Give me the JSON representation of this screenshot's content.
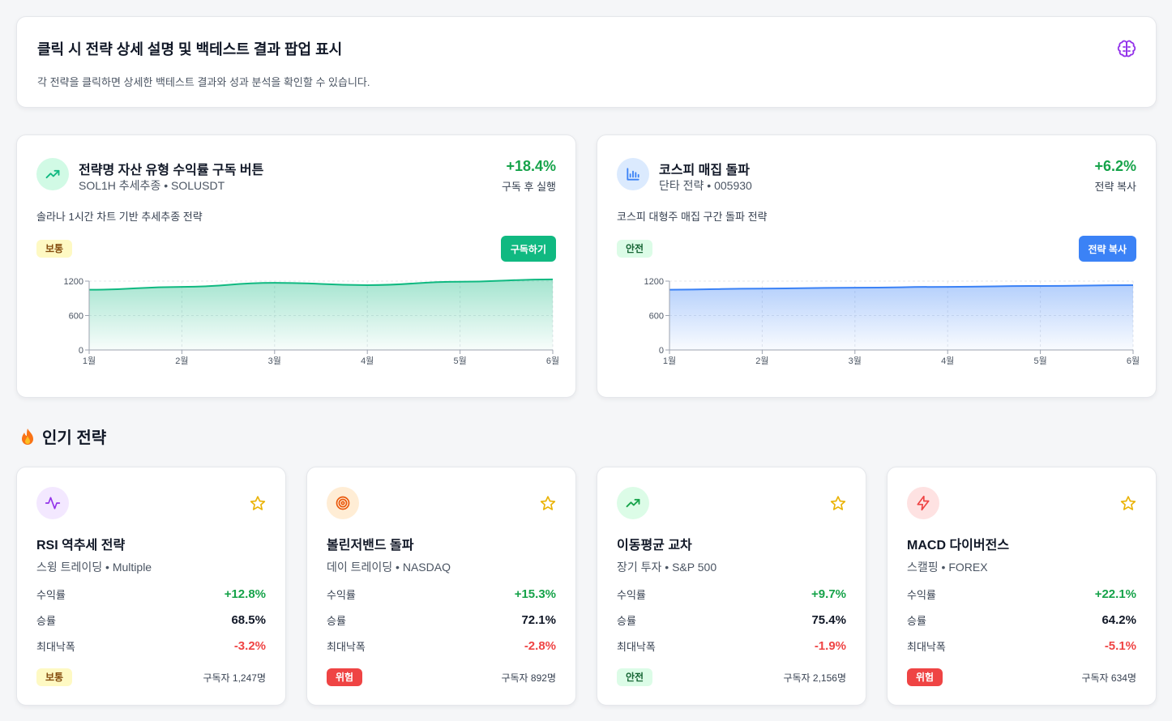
{
  "info": {
    "title": "클릭 시 전략 상세 설명 및 백테스트 결과 팝업 표시",
    "description": "각 전략을 클릭하면 상세한 백테스트 결과와 성과 분석을 확인할 수 있습니다.",
    "icon": "brain-icon",
    "icon_color": "#9333ea"
  },
  "strategies": [
    {
      "icon": "trending-up-icon",
      "name": "전략명 자산 유형 수익률 구독 버튼",
      "subtitle": "SOL1H 추세추종 • SOLUSDT",
      "return": "+18.4%",
      "return_label": "구독 후 실행",
      "description": "솔라나 1시간 차트 기반 추세추종 전략",
      "risk": "보통",
      "action": "구독하기",
      "accent": "#10b981",
      "chart_data": {
        "type": "area",
        "x": [
          "1월",
          "2월",
          "3월",
          "4월",
          "5월",
          "6월"
        ],
        "y_ticks": [
          "0",
          "600",
          "1200"
        ],
        "ylim": [
          0,
          1200
        ],
        "values": [
          1050,
          1100,
          1170,
          1130,
          1190,
          1230
        ]
      }
    },
    {
      "icon": "bar-chart-icon",
      "name": "코스피 매집 돌파",
      "subtitle": "단타 전략 • 005930",
      "return": "+6.2%",
      "return_label": "전략 복사",
      "description": "코스피 대형주 매집 구간 돌파 전략",
      "risk": "안전",
      "action": "전략 복사",
      "accent": "#3b82f6",
      "chart_data": {
        "type": "area",
        "x": [
          "1월",
          "2월",
          "3월",
          "4월",
          "5월",
          "6월"
        ],
        "y_ticks": [
          "0",
          "600",
          "1200"
        ],
        "ylim": [
          0,
          1200
        ],
        "values": [
          1050,
          1070,
          1085,
          1100,
          1115,
          1130
        ]
      }
    }
  ],
  "popular": {
    "title": "인기 전략",
    "icon": "fire-icon",
    "items": [
      {
        "icon": "activity-icon",
        "icon_bg": "#f3e8ff",
        "icon_color": "#9333ea",
        "name": "RSI 역추세 전략",
        "subtitle": "스윙 트레이딩 • Multiple",
        "return_label": "수익률",
        "return": "+12.8%",
        "winrate_label": "승률",
        "winrate": "68.5%",
        "mdd_label": "최대낙폭",
        "mdd": "-3.2%",
        "risk": "보통",
        "risk_class": "b-normal",
        "subscribers": "구독자 1,247명"
      },
      {
        "icon": "target-icon",
        "icon_bg": "#ffedd5",
        "icon_color": "#ea580c",
        "name": "볼린저밴드 돌파",
        "subtitle": "데이 트레이딩 • NASDAQ",
        "return_label": "수익률",
        "return": "+15.3%",
        "winrate_label": "승률",
        "winrate": "72.1%",
        "mdd_label": "최대낙폭",
        "mdd": "-2.8%",
        "risk": "위험",
        "risk_class": "b-risk",
        "subscribers": "구독자 892명"
      },
      {
        "icon": "trending-up-icon",
        "icon_bg": "#dcfce7",
        "icon_color": "#16a34a",
        "name": "이동평균 교차",
        "subtitle": "장기 투자 • S&P 500",
        "return_label": "수익률",
        "return": "+9.7%",
        "winrate_label": "승률",
        "winrate": "75.4%",
        "mdd_label": "최대낙폭",
        "mdd": "-1.9%",
        "risk": "안전",
        "risk_class": "b-safe",
        "subscribers": "구독자 2,156명"
      },
      {
        "icon": "lightning-icon",
        "icon_bg": "#fee2e2",
        "icon_color": "#ef4444",
        "name": "MACD 다이버전스",
        "subtitle": "스캘핑 • FOREX",
        "return_label": "수익률",
        "return": "+22.1%",
        "winrate_label": "승률",
        "winrate": "64.2%",
        "mdd_label": "최대낙폭",
        "mdd": "-5.1%",
        "risk": "위험",
        "risk_class": "b-risk",
        "subscribers": "구독자 634명"
      }
    ]
  }
}
